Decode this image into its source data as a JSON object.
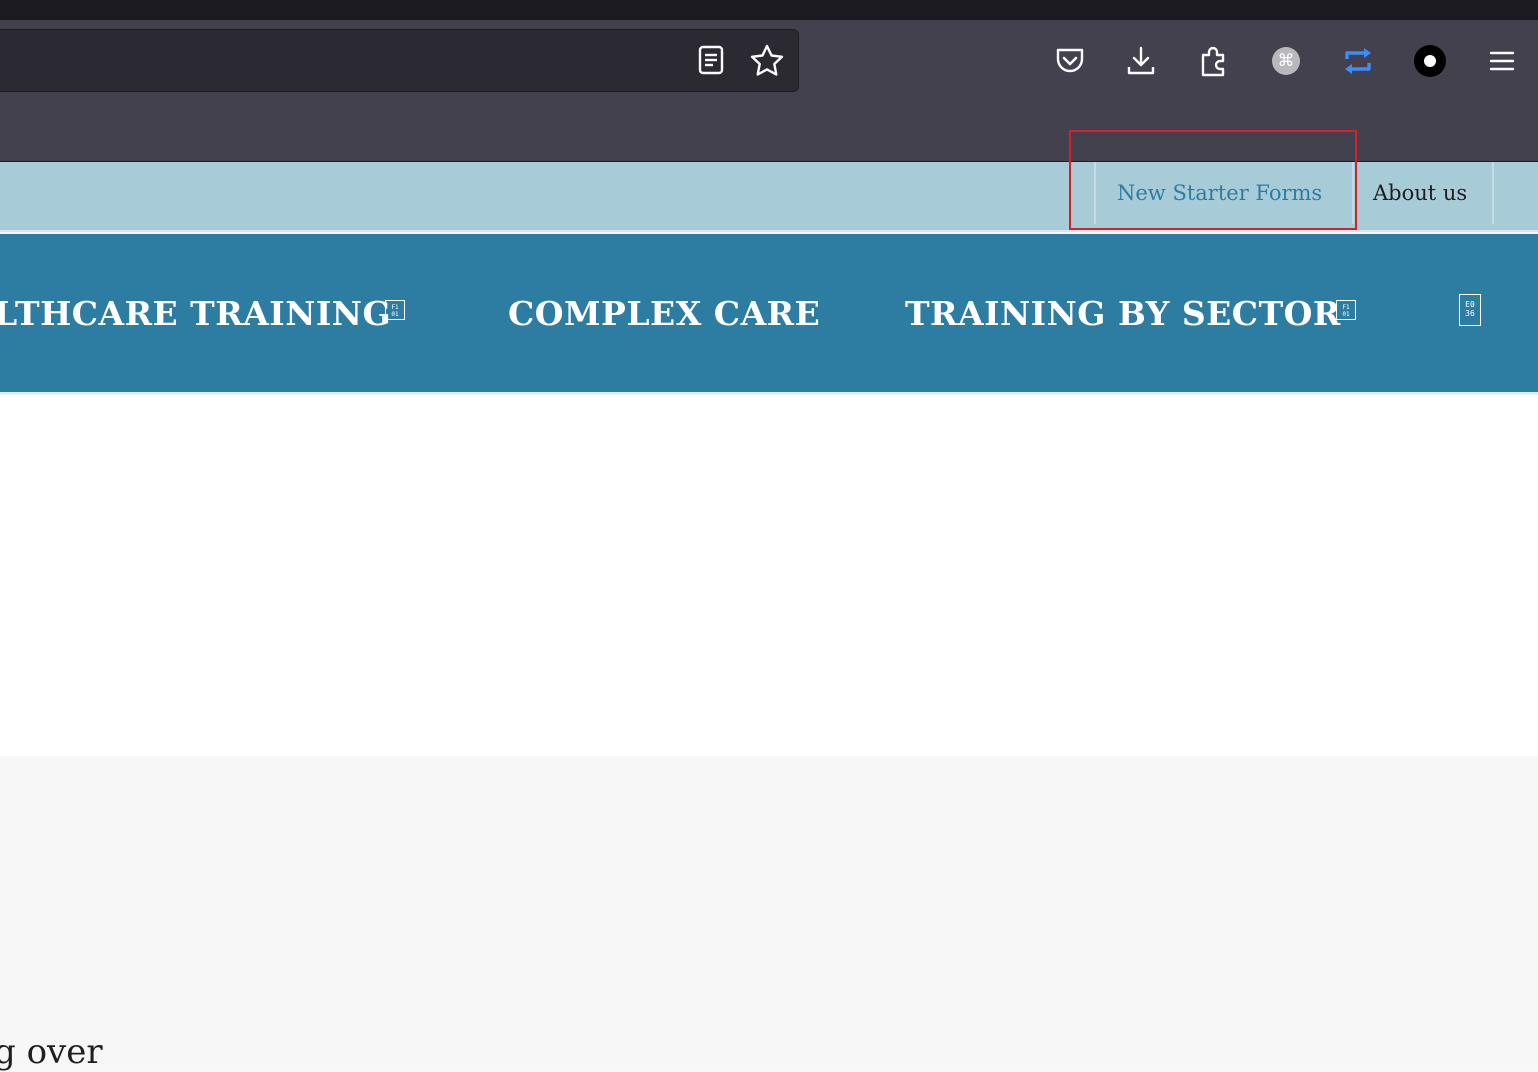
{
  "browser": {
    "url_bar": {
      "reader_icon": "reader-view-icon",
      "bookmark_icon": "star-icon"
    },
    "toolbar_icons": [
      "pocket-icon",
      "download-icon",
      "extensions-icon",
      "command-extension-icon",
      "sync-extension-icon",
      "circle-extension-icon",
      "menu-icon"
    ],
    "extension_glyph": "⌘"
  },
  "page": {
    "top_nav": {
      "items": [
        {
          "label": "New Starter Forms",
          "color": "#2d7da3",
          "highlighted": true
        },
        {
          "label": "About us",
          "color": "#1f1f1f"
        }
      ],
      "highlight_color": "#d7202a"
    },
    "main_nav": {
      "items": [
        {
          "label": "LTHCARE TRAINING",
          "has_dropdown": true
        },
        {
          "label": "COMPLEX CARE",
          "has_dropdown": false
        },
        {
          "label": "TRAINING BY SECTOR",
          "has_dropdown": true
        }
      ],
      "dropdown_glyph": "F1\n01",
      "menu_glyph": "E0\n36",
      "background": "#2d7da3"
    },
    "body_text_fragment": "g over"
  }
}
